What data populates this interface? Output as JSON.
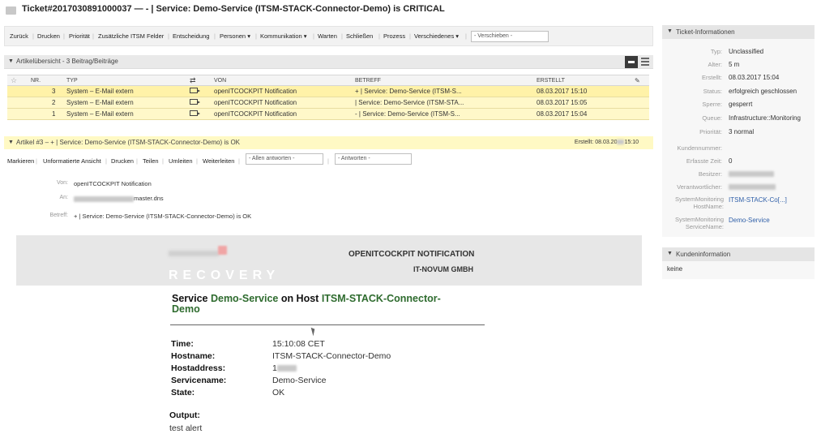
{
  "title": "Ticket#2017030891000037 — - | Service: Demo-Service (ITSM-STACK-Connector-Demo) is CRITICAL",
  "toolbar": {
    "items": [
      "Zurück",
      "Drucken",
      "Priorität",
      "Zusätzliche ITSM Felder",
      "Entscheidung",
      "Personen ▾",
      "Kommunikation ▾",
      "Warten",
      "Schließen",
      "Prozess",
      "Verschiedenes ▾"
    ],
    "move_select": "- Verschieben -"
  },
  "overview": {
    "title": "Artikelübersicht - 3 Beitrag/Beiträge",
    "columns": [
      "NR.",
      "TYP",
      "",
      "VON",
      "BETREFF",
      "ERSTELLT"
    ],
    "rows": [
      {
        "nr": "3",
        "typ": "System – E-Mail extern",
        "von": "openITCOCKPIT Notification",
        "betreff": "+ | Service: Demo-Service (ITSM-S...",
        "erstellt": "08.03.2017 15:10"
      },
      {
        "nr": "2",
        "typ": "System – E-Mail extern",
        "von": "openITCOCKPIT Notification",
        "betreff": "| Service: Demo-Service (ITSM-STA...",
        "erstellt": "08.03.2017 15:05"
      },
      {
        "nr": "1",
        "typ": "System – E-Mail extern",
        "von": "openITCOCKPIT Notification",
        "betreff": "- | Service: Demo-Service (ITSM-S...",
        "erstellt": "08.03.2017 15:04"
      }
    ]
  },
  "article": {
    "title": "Artikel #3 – + | Service: Demo-Service (ITSM-STACK-Connector-Demo) is OK",
    "created_label": "Erstellt:",
    "created_value": "08.03.20",
    "created_value_end": "15:10",
    "actions": [
      "Markieren",
      "Unformatierte Ansicht",
      "Drucken",
      "Teilen",
      "Umleiten",
      "Weiterleiten"
    ],
    "reply_all_select": "- Allen antworten -",
    "reply_select": "- Antworten -",
    "from_label": "Von:",
    "from_value": "openITCOCKPIT Notification",
    "to_label": "An:",
    "to_value_suffix": "master.dns",
    "subject_label": "Betreff:",
    "subject_value": "+ | Service: Demo-Service (ITSM-STACK-Connector-Demo) is OK"
  },
  "email": {
    "recovery": "RECOVERY",
    "notif_title": "OPENITCOCKPIT NOTIFICATION",
    "company": "IT-NOVUM GMBH",
    "headline_prefix": "Service ",
    "service_name": "Demo-Service",
    "headline_mid": " on Host ",
    "host_name": "ITSM-STACK-Connector-Demo",
    "fields": [
      {
        "label": "Time:",
        "value": "15:10:08 CET"
      },
      {
        "label": "Hostname:",
        "value": "ITSM-STACK-Connector-Demo"
      },
      {
        "label": "Hostaddress:",
        "value": "1"
      },
      {
        "label": "Servicename:",
        "value": "Demo-Service"
      },
      {
        "label": "State:",
        "value": "OK"
      }
    ],
    "output_label": "Output:",
    "output_value": "test alert"
  },
  "ticket_info": {
    "header": "Ticket-Informationen",
    "fields": [
      {
        "label": "Typ:",
        "value": "Unclassified"
      },
      {
        "label": "Alter:",
        "value": "5 m"
      },
      {
        "label": "Erstellt:",
        "value": "08.03.2017 15:04"
      },
      {
        "label": "Status:",
        "value": "erfolgreich geschlossen"
      },
      {
        "label": "Sperre:",
        "value": "gesperrt"
      },
      {
        "label": "Queue:",
        "value": "Infrastructure::Monitoring"
      },
      {
        "label": "Priorität:",
        "value": "3 normal"
      },
      {
        "label": "Kundennummer:",
        "value": ""
      },
      {
        "label": "Erfasste Zeit:",
        "value": "0"
      },
      {
        "label": "Besitzer:",
        "value": ""
      },
      {
        "label": "Verantwortlicher:",
        "value": ""
      },
      {
        "label": "SystemMonitoring HostName:",
        "value": "ITSM-STACK-Co[...]"
      },
      {
        "label": "SystemMonitoring ServiceName:",
        "value": "Demo-Service"
      }
    ]
  },
  "customer_info": {
    "header": "Kundeninformation",
    "value": "keine"
  }
}
